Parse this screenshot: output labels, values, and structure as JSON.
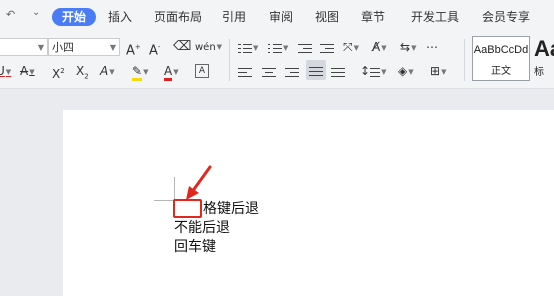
{
  "tabbar": {
    "tabs": [
      {
        "label": "开始",
        "active": true
      },
      {
        "label": "插入",
        "active": false
      },
      {
        "label": "页面布局",
        "active": false
      },
      {
        "label": "引用",
        "active": false
      },
      {
        "label": "审阅",
        "active": false
      },
      {
        "label": "视图",
        "active": false
      },
      {
        "label": "章节",
        "active": false
      },
      {
        "label": "开发工具",
        "active": false
      },
      {
        "label": "会员专享",
        "active": false
      }
    ],
    "accent": "#4a7cf6"
  },
  "ribbon": {
    "font_name": "",
    "font_size": "小四",
    "styles": [
      {
        "sample": "AaBbCcDd",
        "name": "正文"
      },
      {
        "sample": "Aa",
        "name": "标"
      }
    ],
    "icons": [
      "grow-font-icon",
      "shrink-font-icon",
      "clear-format-icon",
      "phonetic-icon",
      "bullets-icon",
      "numbering-icon",
      "decrease-indent-icon",
      "increase-indent-icon",
      "chinese-layout-icon",
      "text-direction-icon",
      "paragraph-mark-icon",
      "underline-icon",
      "strikethrough-icon",
      "superscript-icon",
      "subscript-icon",
      "text-effect-icon",
      "highlight-icon",
      "font-color-icon",
      "char-border-icon",
      "align-left-icon",
      "align-center-icon",
      "align-right-icon",
      "justify-icon",
      "distributed-icon",
      "line-spacing-icon",
      "shading-icon",
      "borders-icon"
    ],
    "highlight_color": "#f5d90a",
    "font_color": "#e02020",
    "underline_color": "#e02020"
  },
  "document": {
    "lines": [
      "格键后退",
      "不能后退",
      "回车键"
    ],
    "annotation_color": "#e0281e"
  }
}
